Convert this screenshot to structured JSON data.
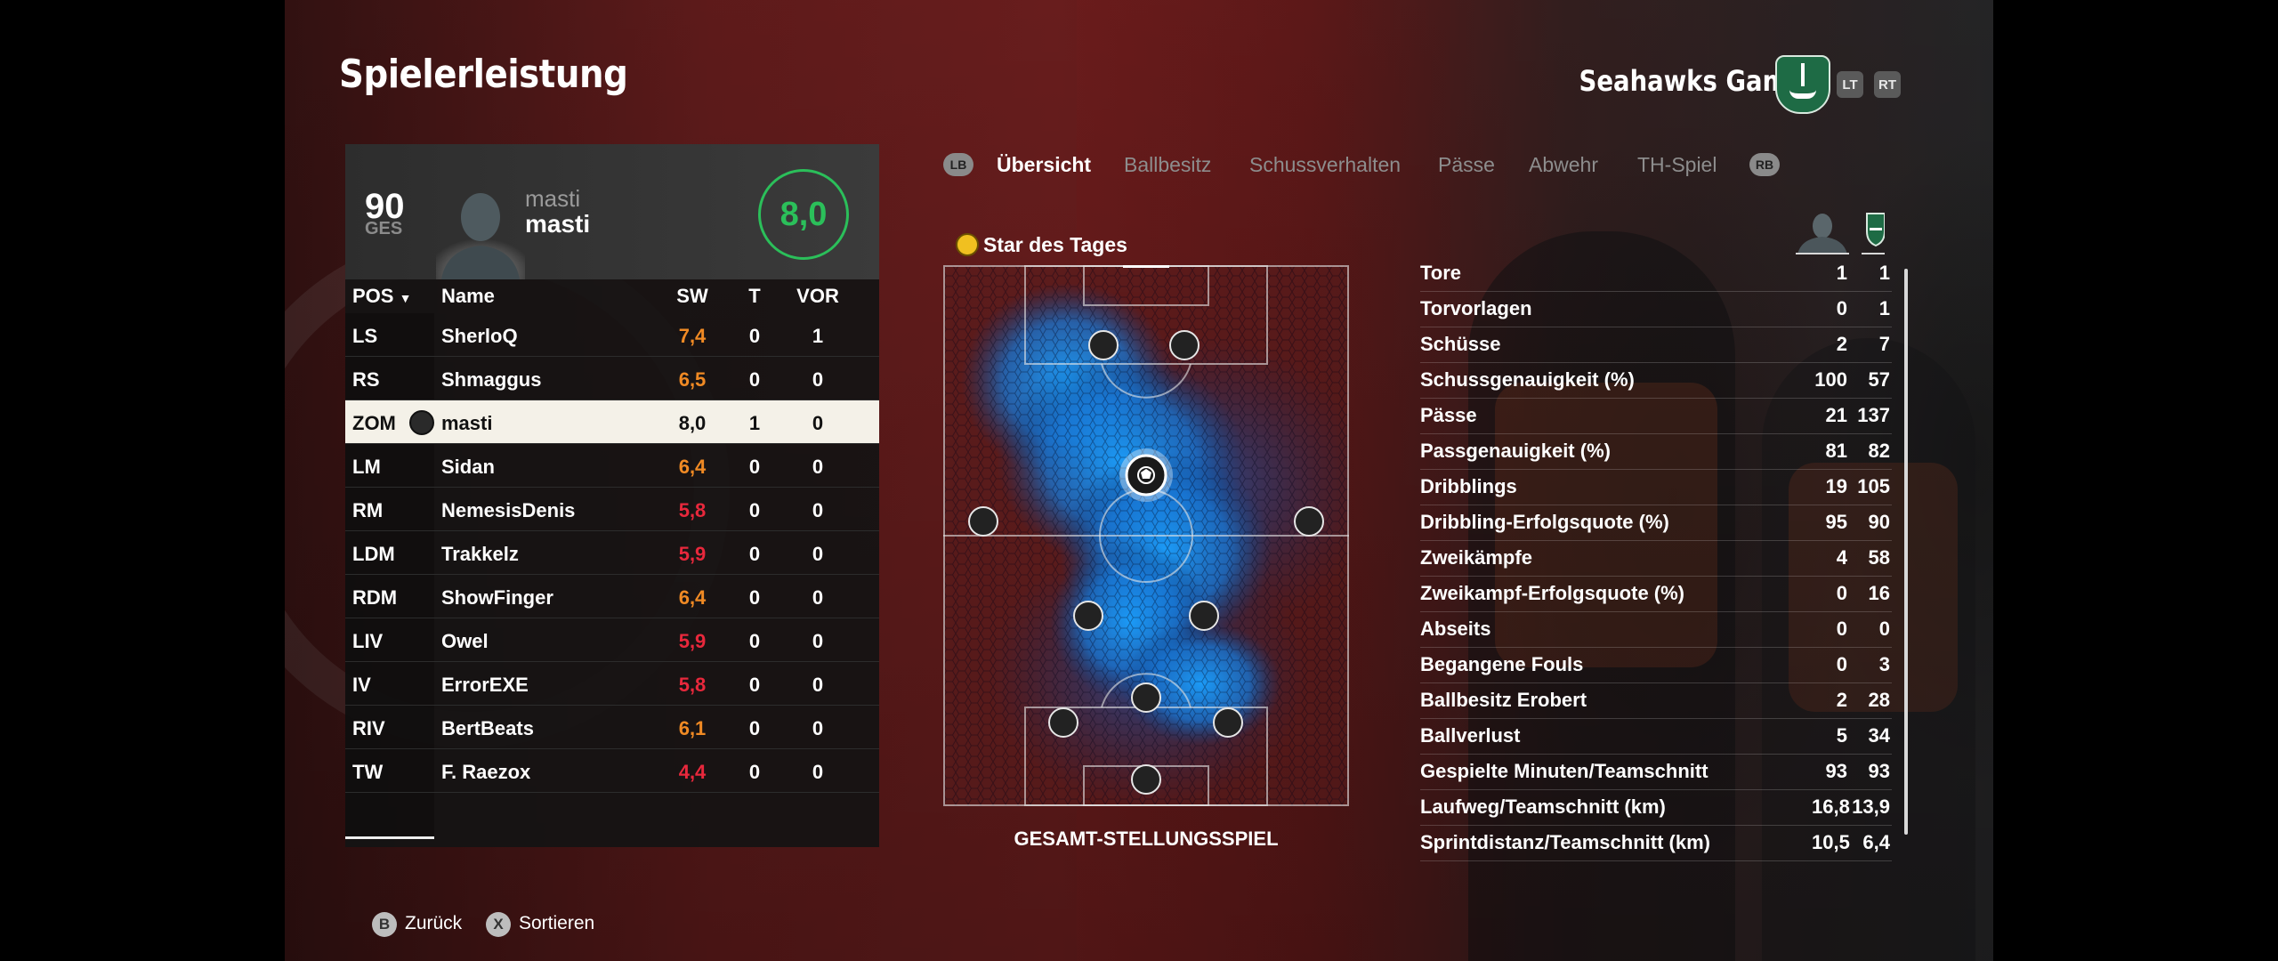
{
  "header": {
    "title": "Spielerleistung",
    "team_name": "Seahawks Gaming",
    "lt_label": "LT",
    "rt_label": "RT"
  },
  "player": {
    "overall": "90",
    "overall_label": "GES",
    "name_top": "masti",
    "name_bottom": "masti",
    "rating": "8,0"
  },
  "table": {
    "headers": {
      "pos": "POS",
      "name": "Name",
      "sw": "SW",
      "t": "T",
      "vor": "VOR"
    },
    "rows": [
      {
        "pos": "LS",
        "name": "SherloQ",
        "sw": "7,4",
        "t": "0",
        "vor": "1",
        "sw_color": "#f08a24"
      },
      {
        "pos": "RS",
        "name": "Shmaggus",
        "sw": "6,5",
        "t": "0",
        "vor": "0",
        "sw_color": "#f08a24"
      },
      {
        "pos": "ZOM",
        "name": "masti",
        "sw": "8,0",
        "t": "1",
        "vor": "0",
        "sw_color": "#111111",
        "selected": true
      },
      {
        "pos": "LM",
        "name": "Sidan",
        "sw": "6,4",
        "t": "0",
        "vor": "0",
        "sw_color": "#f08a24"
      },
      {
        "pos": "RM",
        "name": "NemesisDenis",
        "sw": "5,8",
        "t": "0",
        "vor": "0",
        "sw_color": "#e8283c"
      },
      {
        "pos": "LDM",
        "name": "Trakkelz",
        "sw": "5,9",
        "t": "0",
        "vor": "0",
        "sw_color": "#e8283c"
      },
      {
        "pos": "RDM",
        "name": "ShowFinger",
        "sw": "6,4",
        "t": "0",
        "vor": "0",
        "sw_color": "#f08a24"
      },
      {
        "pos": "LIV",
        "name": "Owel",
        "sw": "5,9",
        "t": "0",
        "vor": "0",
        "sw_color": "#e8283c"
      },
      {
        "pos": "IV",
        "name": "ErrorEXE",
        "sw": "5,8",
        "t": "0",
        "vor": "0",
        "sw_color": "#e8283c"
      },
      {
        "pos": "RIV",
        "name": "BertBeats",
        "sw": "6,1",
        "t": "0",
        "vor": "0",
        "sw_color": "#f08a24"
      },
      {
        "pos": "TW",
        "name": "F. Raezox",
        "sw": "4,4",
        "t": "0",
        "vor": "0",
        "sw_color": "#e8283c"
      }
    ]
  },
  "tabs": {
    "lb": "LB",
    "rb": "RB",
    "items": [
      "Übersicht",
      "Ballbesitz",
      "Schussverhalten",
      "Pässe",
      "Abwehr",
      "TH-Spiel"
    ],
    "active_index": 0
  },
  "heatmap": {
    "star_label": "Star des Tages",
    "caption": "GESAMT-STELLUNGSSPIEL"
  },
  "stats": [
    {
      "label": "Tore",
      "player": "1",
      "team": "1"
    },
    {
      "label": "Torvorlagen",
      "player": "0",
      "team": "1"
    },
    {
      "label": "Schüsse",
      "player": "2",
      "team": "7"
    },
    {
      "label": "Schussgenauigkeit (%)",
      "player": "100",
      "team": "57"
    },
    {
      "label": "Pässe",
      "player": "21",
      "team": "137"
    },
    {
      "label": "Passgenauigkeit (%)",
      "player": "81",
      "team": "82"
    },
    {
      "label": "Dribblings",
      "player": "19",
      "team": "105"
    },
    {
      "label": "Dribbling-Erfolgsquote (%)",
      "player": "95",
      "team": "90"
    },
    {
      "label": "Zweikämpfe",
      "player": "4",
      "team": "58"
    },
    {
      "label": "Zweikampf-Erfolgsquote (%)",
      "player": "0",
      "team": "16"
    },
    {
      "label": "Abseits",
      "player": "0",
      "team": "0"
    },
    {
      "label": "Begangene Fouls",
      "player": "0",
      "team": "3"
    },
    {
      "label": "Ballbesitz Erobert",
      "player": "2",
      "team": "28"
    },
    {
      "label": "Ballverlust",
      "player": "5",
      "team": "34"
    },
    {
      "label": "Gespielte Minuten/Teamschnitt",
      "player": "93",
      "team": "93"
    },
    {
      "label": "Laufweg/Teamschnitt (km)",
      "player": "16,8",
      "team": "13,9"
    },
    {
      "label": "Sprintdistanz/Teamschnitt (km)",
      "player": "10,5",
      "team": "6,4"
    }
  ],
  "footer": {
    "back_key": "B",
    "back_label": "Zurück",
    "sort_key": "X",
    "sort_label": "Sortieren"
  },
  "colors": {
    "rating_green": "#2bbf5a",
    "heat_blue": "#1e90ff",
    "orange": "#f08a24",
    "red": "#e8283c"
  }
}
